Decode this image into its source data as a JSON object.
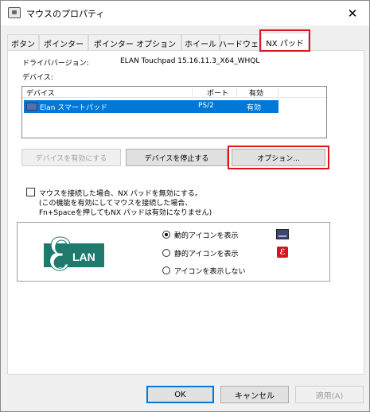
{
  "window": {
    "title": "マウスのプロパティ",
    "close_glyph": "✕"
  },
  "tabs": [
    {
      "label": "ボタン"
    },
    {
      "label": "ポインター"
    },
    {
      "label": "ポインター オプション"
    },
    {
      "label": "ホイール"
    },
    {
      "label": "ハードウェア"
    },
    {
      "label": "NX パッド"
    }
  ],
  "driver": {
    "label": "ドライババージョン:",
    "value": "ELAN Touchpad 15.16.11.3_X64_WHQL"
  },
  "devices": {
    "label": "デバイス:",
    "columns": [
      "デバイス",
      "ポート",
      "有効"
    ],
    "rows": [
      {
        "name": "Elan スマートパッド",
        "port": "PS/2",
        "enabled": "有効"
      }
    ]
  },
  "buttons": {
    "enable": "デバイスを有効にする",
    "stop": "デバイスを停止する",
    "options": "オプション..."
  },
  "disable_option": {
    "line1": "マウスを接続した場合、NX パッドを無効にする。",
    "line2": "(この機能を有効にしてマウスを接続した場合、",
    "line3": "Fn+Spaceを押してもNX パッドは有効になりません)"
  },
  "icon_options": {
    "logo_text": "LAN",
    "logo_letter": "E",
    "dynamic": "動的アイコンを表示",
    "static": "静的アイコンを表示",
    "none": "アイコンを表示しない",
    "static_icon_glyph": "ℰ"
  },
  "footer": {
    "ok": "OK",
    "cancel": "キャンセル",
    "apply": "適用(A)"
  },
  "colors": {
    "highlight": "#e0131a",
    "selection": "#0078d7",
    "logo_green": "#1f7a6e"
  }
}
